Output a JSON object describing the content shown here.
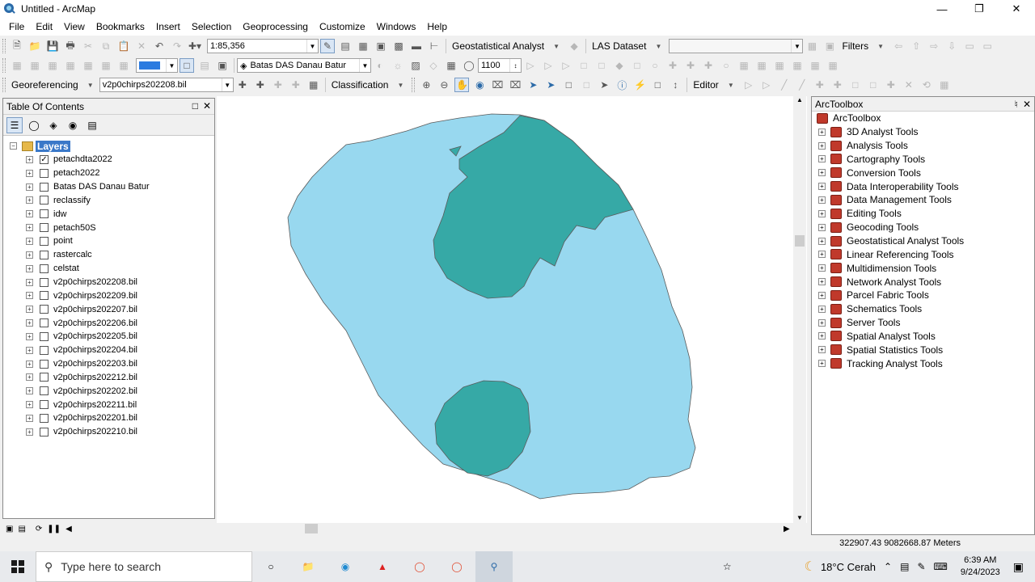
{
  "window": {
    "title": "Untitled - ArcMap"
  },
  "menu": [
    "File",
    "Edit",
    "View",
    "Bookmarks",
    "Insert",
    "Selection",
    "Geoprocessing",
    "Customize",
    "Windows",
    "Help"
  ],
  "toolbar1": {
    "scale": "1:85,356",
    "geostat_label": "Geostatistical Analyst",
    "las_label": "LAS Dataset",
    "filters_label": "Filters"
  },
  "toolbar2": {
    "layer_combo": "Batas DAS Danau Batur",
    "elevation_value": "1100"
  },
  "toolbar3": {
    "georef_label": "Georeferencing",
    "georef_layer": "v2p0chirps202208.bil",
    "classification_label": "Classification",
    "editor_label": "Editor"
  },
  "toc": {
    "title": "Table Of Contents",
    "root_label": "Layers",
    "layers": [
      {
        "name": "petachdta2022",
        "checked": "✓"
      },
      {
        "name": "petach2022",
        "checked": ""
      },
      {
        "name": "Batas DAS Danau Batur",
        "checked": ""
      },
      {
        "name": "reclassify",
        "checked": ""
      },
      {
        "name": "idw",
        "checked": ""
      },
      {
        "name": "petach50S",
        "checked": ""
      },
      {
        "name": "point",
        "checked": ""
      },
      {
        "name": "rastercalc",
        "checked": ""
      },
      {
        "name": "celstat",
        "checked": ""
      },
      {
        "name": "v2p0chirps202208.bil",
        "checked": ""
      },
      {
        "name": "v2p0chirps202209.bil",
        "checked": ""
      },
      {
        "name": "v2p0chirps202207.bil",
        "checked": ""
      },
      {
        "name": "v2p0chirps202206.bil",
        "checked": ""
      },
      {
        "name": "v2p0chirps202205.bil",
        "checked": ""
      },
      {
        "name": "v2p0chirps202204.bil",
        "checked": ""
      },
      {
        "name": "v2p0chirps202203.bil",
        "checked": ""
      },
      {
        "name": "v2p0chirps202212.bil",
        "checked": ""
      },
      {
        "name": "v2p0chirps202202.bil",
        "checked": ""
      },
      {
        "name": "v2p0chirps202211.bil",
        "checked": ""
      },
      {
        "name": "v2p0chirps202201.bil",
        "checked": ""
      },
      {
        "name": "v2p0chirps202210.bil",
        "checked": ""
      }
    ]
  },
  "toolbox": {
    "title": "ArcToolbox",
    "root_label": "ArcToolbox",
    "tools": [
      "3D Analyst Tools",
      "Analysis Tools",
      "Cartography Tools",
      "Conversion Tools",
      "Data Interoperability Tools",
      "Data Management Tools",
      "Editing Tools",
      "Geocoding Tools",
      "Geostatistical Analyst Tools",
      "Linear Referencing Tools",
      "Multidimension Tools",
      "Network Analyst Tools",
      "Parcel Fabric Tools",
      "Schematics Tools",
      "Server Tools",
      "Spatial Analyst Tools",
      "Spatial Statistics Tools",
      "Tracking Analyst Tools"
    ]
  },
  "status": {
    "coordinates": "322907.43  9082668.87 Meters"
  },
  "taskbar": {
    "search_placeholder": "Type here to search",
    "weather": "18°C  Cerah",
    "time": "6:39 AM",
    "date": "9/24/2023"
  },
  "colors": {
    "map_light": "#98d8ef",
    "map_dark": "#36a9a6",
    "selection": "#3a78c8"
  }
}
